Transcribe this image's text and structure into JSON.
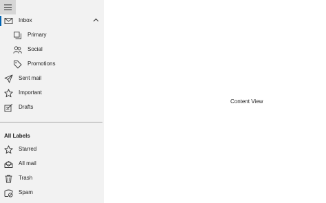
{
  "pane": {
    "menu_icon": "hamburger-icon",
    "selection_color": "#0063b1",
    "items": [
      {
        "label": "Inbox",
        "icon": "mail-icon",
        "level": "top",
        "selected": true,
        "expanded": true
      },
      {
        "label": "Primary",
        "icon": "primary-icon",
        "level": "sub"
      },
      {
        "label": "Social",
        "icon": "people-icon",
        "level": "sub"
      },
      {
        "label": "Promotions",
        "icon": "tag-icon",
        "level": "sub"
      },
      {
        "label": "Sent mail",
        "icon": "send-icon",
        "level": "top"
      },
      {
        "label": "Important",
        "icon": "star-icon",
        "level": "top"
      },
      {
        "label": "Drafts",
        "icon": "draft-icon",
        "level": "top"
      }
    ],
    "labels_header": "All Labels",
    "labels": [
      {
        "label": "Starred",
        "icon": "star-icon"
      },
      {
        "label": "All mail",
        "icon": "all-mail-icon"
      },
      {
        "label": "Trash",
        "icon": "trash-icon"
      },
      {
        "label": "Spam",
        "icon": "spam-icon"
      }
    ]
  },
  "content": {
    "text": "Content View"
  }
}
